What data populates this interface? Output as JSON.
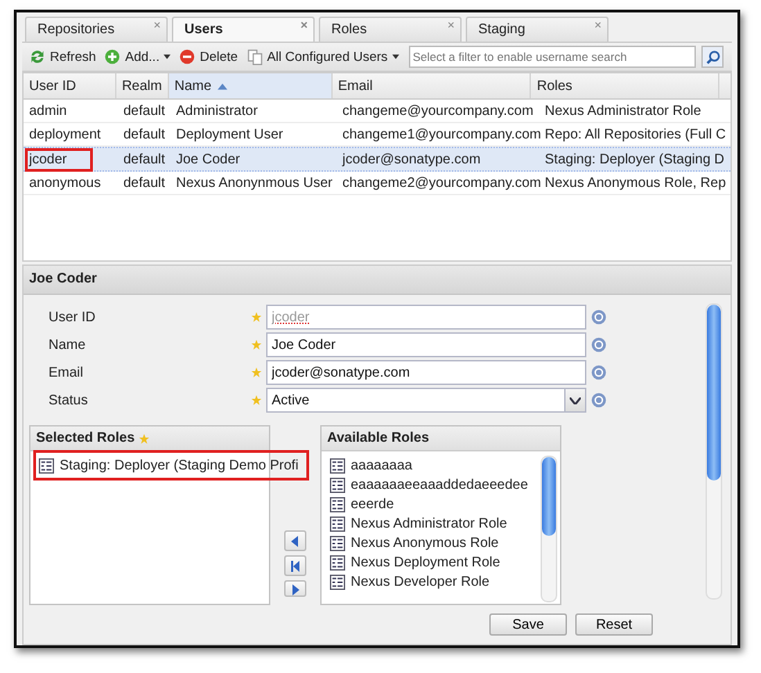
{
  "tabs": [
    {
      "label": "Repositories",
      "selected": false,
      "close": "×"
    },
    {
      "label": "Users",
      "selected": true,
      "close": "×"
    },
    {
      "label": "Roles",
      "selected": false,
      "close": "×"
    },
    {
      "label": "Staging",
      "selected": false,
      "close": "×"
    }
  ],
  "toolbar": {
    "buttons": [
      {
        "label": "Refresh",
        "kind": "refresh"
      },
      {
        "label": "Add...",
        "kind": "add"
      },
      {
        "label": "Delete",
        "kind": "delete"
      },
      {
        "label": "All Configured Users",
        "kind": "menu"
      }
    ],
    "search": {
      "placeholder": "Select a filter to enable username search"
    }
  },
  "table": {
    "columns": [
      {
        "label": "User ID",
        "sorted": false
      },
      {
        "label": "Realm",
        "sorted": false
      },
      {
        "label": "Name",
        "sorted": true
      },
      {
        "label": "Email",
        "sorted": false
      },
      {
        "label": "Roles",
        "sorted": false
      }
    ],
    "rows": [
      {
        "selected": false,
        "highlighted": false,
        "cells": [
          "admin",
          "default",
          "Administrator",
          "changeme@yourcompany.com",
          "Nexus Administrator Role"
        ]
      },
      {
        "selected": false,
        "highlighted": false,
        "cells": [
          "deployment",
          "default",
          "Deployment User",
          "changeme1@yourcompany.com",
          "Repo: All Repositories (Full C"
        ]
      },
      {
        "selected": true,
        "highlighted": true,
        "cells": [
          "jcoder",
          "default",
          "Joe Coder",
          "jcoder@sonatype.com",
          "Staging: Deployer (Staging D"
        ]
      },
      {
        "selected": false,
        "highlighted": false,
        "cells": [
          "anonymous",
          "default",
          "Nexus Anonynmous User",
          "changeme2@yourcompany.com",
          "Nexus Anonymous Role, Rep"
        ]
      }
    ]
  },
  "detail": {
    "title": "Joe Coder",
    "fields": [
      {
        "label": "User ID",
        "value": "jcoder",
        "kind": "text",
        "disabled": true
      },
      {
        "label": "Name",
        "value": "Joe Coder",
        "kind": "text",
        "disabled": false
      },
      {
        "label": "Email",
        "value": "jcoder@sonatype.com",
        "kind": "text",
        "disabled": false
      },
      {
        "label": "Status",
        "value": "Active",
        "kind": "select",
        "disabled": false
      }
    ],
    "selected_roles": {
      "title": "Selected Roles",
      "items": [
        {
          "label": "Staging: Deployer (Staging Demo Profi",
          "highlighted": true
        }
      ]
    },
    "available_roles": {
      "title": "Available Roles",
      "items": [
        {
          "label": "aaaaaaaa"
        },
        {
          "label": "eaaaaaaeeaaaddedaeeedee"
        },
        {
          "label": "eeerde"
        },
        {
          "label": "Nexus Administrator Role"
        },
        {
          "label": "Nexus Anonymous Role"
        },
        {
          "label": "Nexus Deployment Role"
        },
        {
          "label": "Nexus Developer Role"
        }
      ]
    },
    "buttons": [
      {
        "label": "Save"
      },
      {
        "label": "Reset"
      }
    ]
  }
}
